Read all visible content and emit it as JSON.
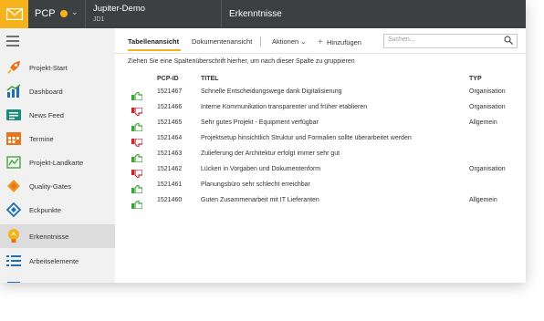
{
  "topbar": {
    "brand": "PCP",
    "project_name": "Jupiter-Demo",
    "project_id": "JD1",
    "section_title": "Erkenntnisse"
  },
  "sidebar": {
    "items": [
      {
        "label": "Projekt-Start",
        "icon": "rocket-icon",
        "active": false
      },
      {
        "label": "Dashboard",
        "icon": "dashboard-icon",
        "active": false
      },
      {
        "label": "News Feed",
        "icon": "newsfeed-icon",
        "active": false
      },
      {
        "label": "Termine",
        "icon": "calendar-icon",
        "active": false
      },
      {
        "label": "Projekt-Landkarte",
        "icon": "map-icon",
        "active": false
      },
      {
        "label": "Quality-Gates",
        "icon": "quality-gate-icon",
        "active": false
      },
      {
        "label": "Eckpunkte",
        "icon": "milestone-icon",
        "active": false
      },
      {
        "label": "Erkenntnisse",
        "icon": "lightbulb-icon",
        "active": true
      },
      {
        "label": "Arbeitselemente",
        "icon": "checklist-icon",
        "active": false
      }
    ]
  },
  "toolbar": {
    "tab_table": "Tabellenansicht",
    "tab_documents": "Dokumentenansicht",
    "actions": "Aktionen",
    "add": "Hinzufügen",
    "search_placeholder": "Suchen..."
  },
  "grid": {
    "group_hint": "Ziehen Sie eine Spaltenüberschrift hierher, um nach dieser Spalte zu gruppieren",
    "columns": {
      "id": "PCP-ID",
      "title": "TITEL",
      "type": "TYP"
    },
    "rows": [
      {
        "sentiment": "positive",
        "id": "1521467",
        "title": "Schnelle Entscheidungswege dank Digitalisierung",
        "type": "Organisation"
      },
      {
        "sentiment": "negative",
        "id": "1521466",
        "title": "Interne Kommunikation transparenter und früher etablieren",
        "type": "Organisation"
      },
      {
        "sentiment": "positive",
        "id": "1521465",
        "title": "Sehr gutes Projekt - Equipment verfügbar",
        "type": "Allgemein"
      },
      {
        "sentiment": "negative",
        "id": "1521464",
        "title": "Projektsetup hinsichtlich Struktur und Formalien sollte überarbeitet werden",
        "type": ""
      },
      {
        "sentiment": "positive",
        "id": "1521463",
        "title": "Zulieferung der Architektur erfolgt immer sehr gut",
        "type": ""
      },
      {
        "sentiment": "negative",
        "id": "1521462",
        "title": "Lücken in Vorgaben und Dokumentenform",
        "type": "Organisation"
      },
      {
        "sentiment": "positive",
        "id": "1521461",
        "title": "Planungsbüro sehr schlecht erreichbar",
        "type": ""
      },
      {
        "sentiment": "positive",
        "id": "1521460",
        "title": "Guten Zusammenarbeit mit IT Lieferanten",
        "type": "Allgemein"
      }
    ]
  },
  "colors": {
    "accent": "#f6b21b",
    "topbar": "#3c4043",
    "positive": "#3aa335",
    "negative": "#c9252c"
  }
}
